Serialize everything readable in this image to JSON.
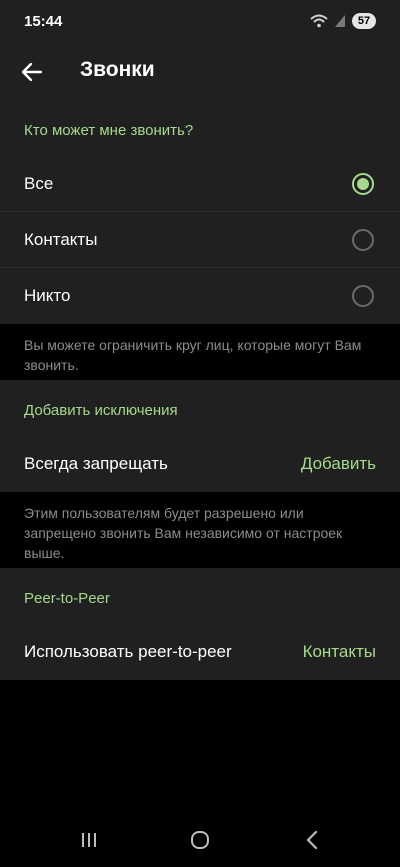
{
  "status_bar": {
    "time": "15:44",
    "battery": "57"
  },
  "app_bar": {
    "title": "Звонки",
    "back_icon": "arrow-left-icon"
  },
  "who_can_call": {
    "header": "Кто может мне звонить?",
    "options": [
      {
        "label": "Все",
        "selected": true
      },
      {
        "label": "Контакты",
        "selected": false
      },
      {
        "label": "Никто",
        "selected": false
      }
    ],
    "hint": "Вы можете ограничить круг лиц, которые могут Вам звонить."
  },
  "exceptions": {
    "header": "Добавить исключения",
    "row_label": "Всегда запрещать",
    "row_action": "Добавить",
    "hint": "Этим пользователям будет разрешено или запрещено звонить Вам независимо от настроек выше."
  },
  "p2p": {
    "header": "Peer-to-Peer",
    "row_label": "Использовать peer-to-peer",
    "row_value": "Контакты"
  },
  "colors": {
    "accent": "#a5d98b",
    "surface": "#202020",
    "background": "#000000",
    "hint_text": "#8c8c8c"
  },
  "nav_bar": {
    "icons": [
      "recent-apps-icon",
      "home-icon",
      "back-nav-icon"
    ]
  }
}
